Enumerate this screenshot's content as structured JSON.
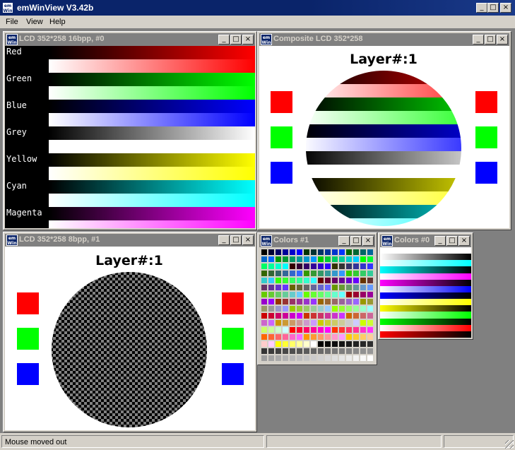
{
  "app": {
    "title": "emWinView V3.42b",
    "logo_text": "em\nWin"
  },
  "menu": {
    "items": [
      "File",
      "View",
      "Help"
    ]
  },
  "title_buttons": {
    "minimize": "_",
    "maximize": "□",
    "close": "×"
  },
  "windows": {
    "lcd16": {
      "title": "LCD 352*258 16bpp, #0",
      "rows": [
        {
          "label": "Red",
          "color": "#ff0000"
        },
        {
          "label": "Green",
          "color": "#00ff00"
        },
        {
          "label": "Blue",
          "color": "#0000ff"
        },
        {
          "label": "Grey",
          "color": "#ffffff"
        },
        {
          "label": "Yellow",
          "color": "#ffff00"
        },
        {
          "label": "Cyan",
          "color": "#00ffff"
        },
        {
          "label": "Magenta",
          "color": "#ff00ff"
        }
      ]
    },
    "composite": {
      "title": "Composite LCD 352*258",
      "heading": "Layer#:1"
    },
    "lcd8": {
      "title": "LCD 352*258 8bpp, #1",
      "heading": "Layer#:1"
    },
    "colors1": {
      "title": "Colors #1"
    },
    "colors0": {
      "title": "Colors #0"
    }
  },
  "squares": [
    "#ff0000",
    "#00ff00",
    "#0000ff"
  ],
  "statusbar": {
    "text": "Mouse moved out"
  }
}
